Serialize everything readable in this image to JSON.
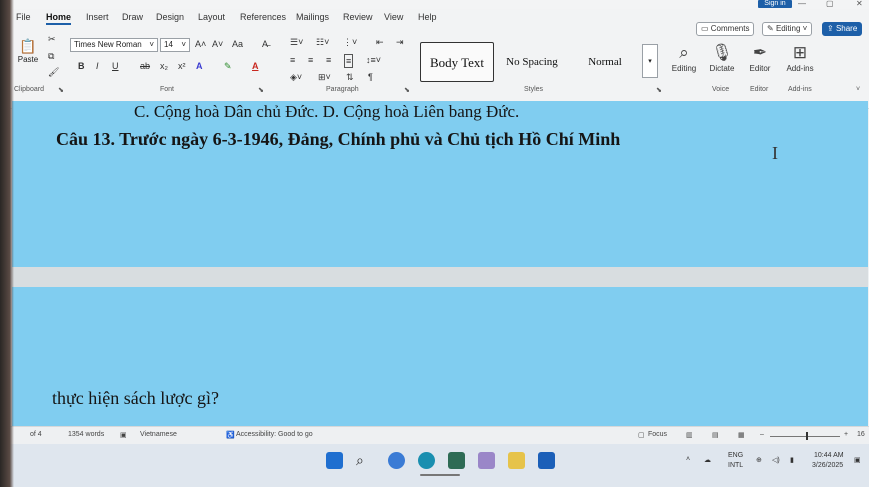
{
  "titlebar": {
    "signin_label": "Sign in",
    "minimize": "—",
    "restore": "▢",
    "close": "✕"
  },
  "tabs": [
    "File",
    "Home",
    "Insert",
    "Draw",
    "Design",
    "Layout",
    "References",
    "Mailings",
    "Review",
    "View",
    "Help"
  ],
  "topbar": {
    "comments_label": "Comments",
    "editing_label": "Editing",
    "share_label": "Share"
  },
  "clipboard": {
    "paste_label": "Paste",
    "group_label": "Clipboard"
  },
  "font": {
    "name": "Times New Roman",
    "size": "14",
    "grow_icon": "A˄",
    "shrink_icon": "A˅",
    "case_icon": "Aa",
    "bold": "B",
    "italic": "I",
    "underline": "U",
    "strike": "ab",
    "subscript": "x₂",
    "superscript": "x²",
    "group_label": "Font"
  },
  "paragraph": {
    "group_label": "Paragraph"
  },
  "styles": {
    "items": [
      "Body Text",
      "No Spacing",
      "Normal"
    ],
    "group_label": "Styles"
  },
  "editing": {
    "label": "Editing"
  },
  "voice": {
    "dictate_label": "Dictate",
    "group_label": "Voice"
  },
  "editor": {
    "label": "Editor",
    "group_label": "Editor"
  },
  "addins": {
    "label": "Add-ins",
    "group_label": "Add-ins"
  },
  "document": {
    "line_options": "C. Cộng hoà Dân chủ Đức.          D. Cộng hoà Liên bang Đức.",
    "question": "Câu 13. Trước ngày 6-3-1946, Đảng, Chính phủ và Chủ tịch Hồ Chí Minh",
    "continuation": "thực hiện sách lược gì?"
  },
  "status": {
    "page": "of 4",
    "words": "1354 words",
    "language": "Vietnamese",
    "accessibility": "Accessibility: Good to go",
    "focus": "Focus",
    "zoom_pct": "16"
  },
  "tray": {
    "lang_top": "ENG",
    "lang_bottom": "INTL",
    "time": "10:44 AM",
    "date": "3/26/2025"
  },
  "colors": {
    "accent": "#1d5fa8",
    "doc_bg": "#80cdf0"
  }
}
